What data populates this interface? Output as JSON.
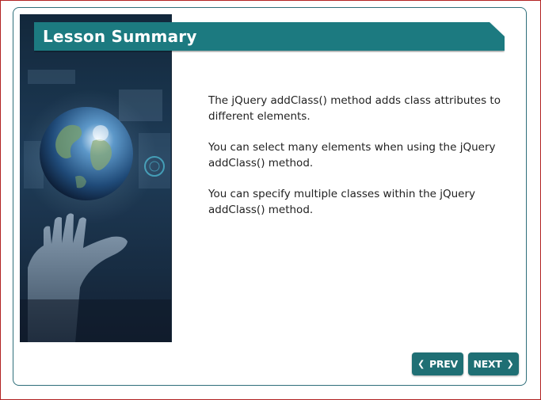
{
  "lesson": {
    "title": "Lesson Summary",
    "paragraphs": [
      "The jQuery addClass() method adds class attributes to different elements.",
      "You can select many elements when using the jQuery addClass() method.",
      "You can specify multiple classes within the jQuery addClass() method."
    ]
  },
  "nav": {
    "prev_label": "PREV",
    "next_label": "NEXT",
    "prev_icon": "chevron-left-icon",
    "next_icon": "chevron-right-icon"
  },
  "colors": {
    "banner": "#1f7a80",
    "button": "#1f6f74",
    "frame_border": "#2f6f7a",
    "outer_border": "#b22222"
  }
}
